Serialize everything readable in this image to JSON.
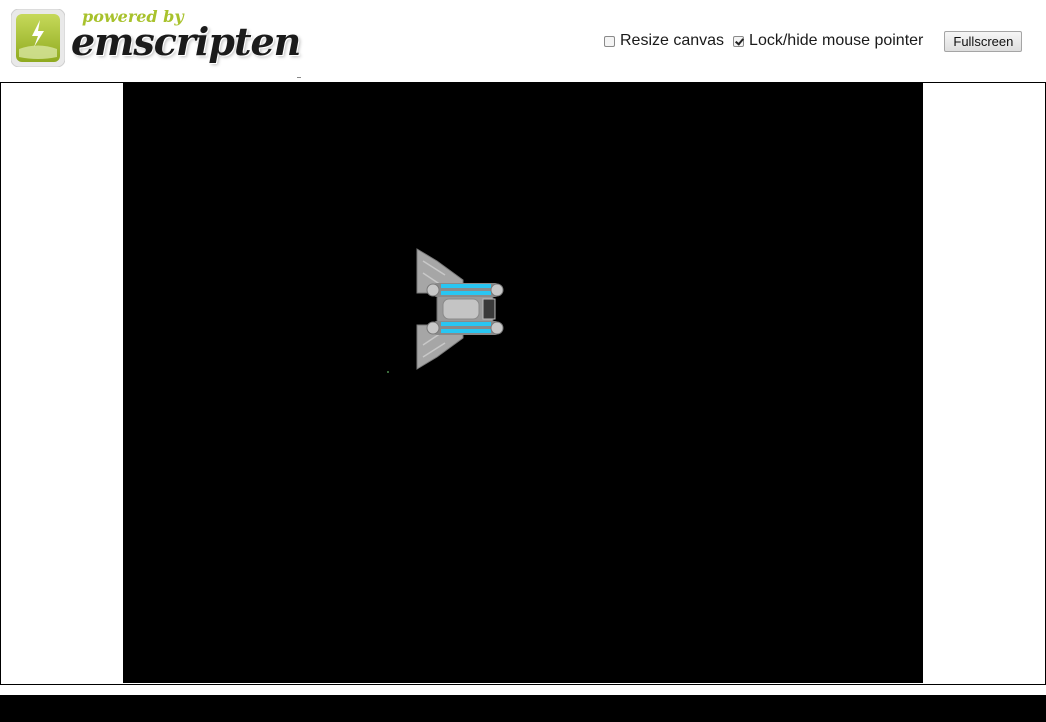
{
  "header": {
    "logo": {
      "powered_by": "powered by",
      "brand": "emscripten",
      "badge_icon": "lightning-bolt-icon",
      "colors": {
        "badge_green": "#a8c22c",
        "text_dark": "#1b1b1b"
      }
    },
    "controls": {
      "resize_canvas": {
        "label": "Resize canvas",
        "checked": false
      },
      "lock_pointer": {
        "label": "Lock/hide mouse pointer",
        "checked": true
      },
      "fullscreen_label": "Fullscreen"
    }
  },
  "game": {
    "canvas_background": "#000000",
    "sprites": [
      {
        "name": "spaceship",
        "icon": "spaceship-sprite",
        "colors": {
          "hull": "#a6a6a6",
          "thruster": "#29c6f2"
        }
      }
    ]
  }
}
